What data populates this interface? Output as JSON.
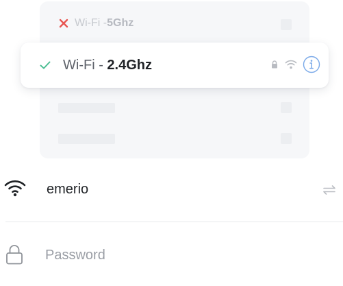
{
  "networks": {
    "unavailable": {
      "ssid": "Wi-Fi - ",
      "band": "5Ghz",
      "status_icon": "x-icon"
    },
    "selected": {
      "ssid": "Wi-Fi - ",
      "band": "2.4Ghz",
      "status_icon": "check-icon",
      "secure_icon": "lock-icon",
      "signal_icon": "wifi-icon",
      "info_icon": "info-icon"
    }
  },
  "form": {
    "network_name": "emerio",
    "network_icon": "wifi-icon",
    "switch_icon": "swap-arrows-icon",
    "password_placeholder": "Password",
    "password_value": "",
    "password_icon": "lock-outline-icon"
  },
  "colors": {
    "error_red": "#e85450",
    "success_green": "#4dbf94",
    "info_blue": "#7aa9e8",
    "text_dark": "#1f2226",
    "text_muted": "#9a9ea5"
  }
}
